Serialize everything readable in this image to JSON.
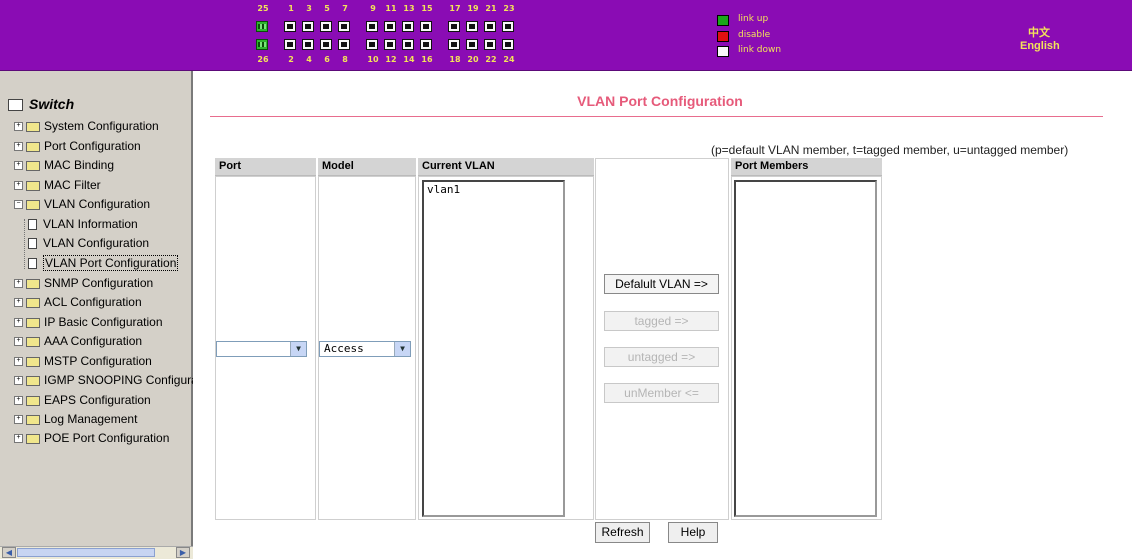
{
  "banner": {
    "top_port_numbers": [
      "25",
      "1",
      "3",
      "5",
      "7",
      "9",
      "11",
      "13",
      "15",
      "17",
      "19",
      "21",
      "23"
    ],
    "bottom_port_numbers": [
      "26",
      "2",
      "4",
      "6",
      "8",
      "10",
      "12",
      "14",
      "16",
      "18",
      "20",
      "22",
      "24"
    ],
    "legend": [
      {
        "label": "link up",
        "color": "#1aa81a"
      },
      {
        "label": "disable",
        "color": "#e01010"
      },
      {
        "label": "link down",
        "color": "#f8f8f8"
      }
    ],
    "lang_chinese": "中文",
    "lang_english": "English",
    "colors": {
      "banner": "#8a0cb4",
      "text": "#f3e35a"
    }
  },
  "sidebar": {
    "root": "Switch",
    "items": [
      {
        "label": "System Configuration"
      },
      {
        "label": "Port Configuration"
      },
      {
        "label": "MAC Binding"
      },
      {
        "label": "MAC Filter"
      },
      {
        "label": "VLAN Configuration"
      },
      {
        "label": "SNMP Configuration"
      },
      {
        "label": "ACL Configuration"
      },
      {
        "label": "IP Basic Configuration"
      },
      {
        "label": "AAA Configuration"
      },
      {
        "label": "MSTP Configuration"
      },
      {
        "label": "IGMP SNOOPING Configura"
      },
      {
        "label": "EAPS Configuration"
      },
      {
        "label": "Log Management"
      },
      {
        "label": "POE Port Configuration"
      }
    ],
    "subitems": [
      {
        "label": "VLAN Information"
      },
      {
        "label": "VLAN Configuration"
      },
      {
        "label": "VLAN Port Configuration"
      }
    ]
  },
  "main": {
    "title": "VLAN Port Configuration",
    "legend_note": "(p=default VLAN member, t=tagged member, u=untagged member)",
    "columns": {
      "port": "Port",
      "model": "Model",
      "current_vlan": "Current VLAN",
      "port_members": "Port Members"
    },
    "port_select_value": "",
    "model_select_value": "Access",
    "current_vlan_items": [
      "vlan1"
    ],
    "port_member_items": [],
    "buttons": {
      "default_vlan": "Defalult  VLAN =>",
      "tagged": "tagged =>",
      "untagged": "untagged =>",
      "unmember": "unMember <=",
      "refresh": "Refresh",
      "help": "Help"
    }
  }
}
